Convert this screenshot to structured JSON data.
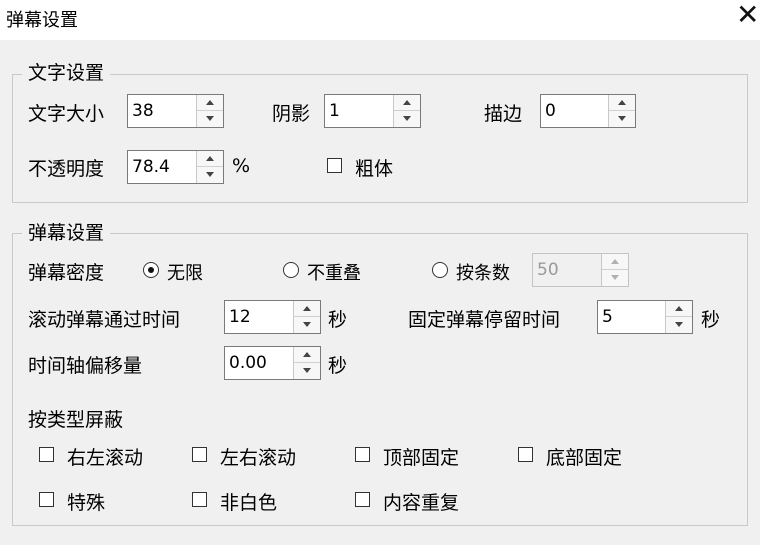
{
  "window": {
    "title": "弹幕设置",
    "close_glyph": "✕"
  },
  "text_group": {
    "legend": "文字设置",
    "font_size_label": "文字大小",
    "font_size_value": "38",
    "shadow_label": "阴影",
    "shadow_value": "1",
    "stroke_label": "描边",
    "stroke_value": "0",
    "opacity_label": "不透明度",
    "opacity_value": "78.4",
    "opacity_unit": "%",
    "bold_label": "粗体",
    "bold_checked": false
  },
  "danmaku_group": {
    "legend": "弹幕设置",
    "density_label": "弹幕密度",
    "density_options": [
      {
        "label": "无限",
        "selected": true
      },
      {
        "label": "不重叠",
        "selected": false
      },
      {
        "label": "按条数",
        "selected": false
      }
    ],
    "count_value": "50",
    "scroll_time_label": "滚动弹幕通过时间",
    "scroll_time_value": "12",
    "scroll_time_unit": "秒",
    "fixed_time_label": "固定弹幕停留时间",
    "fixed_time_value": "5",
    "fixed_time_unit": "秒",
    "offset_label": "时间轴偏移量",
    "offset_value": "0.00",
    "offset_unit": "秒",
    "block_label": "按类型屏蔽",
    "block_types": [
      {
        "label": "右左滚动",
        "checked": false
      },
      {
        "label": "左右滚动",
        "checked": false
      },
      {
        "label": "顶部固定",
        "checked": false
      },
      {
        "label": "底部固定",
        "checked": false
      },
      {
        "label": "特殊",
        "checked": false
      },
      {
        "label": "非白色",
        "checked": false
      },
      {
        "label": "内容重复",
        "checked": false
      }
    ]
  }
}
